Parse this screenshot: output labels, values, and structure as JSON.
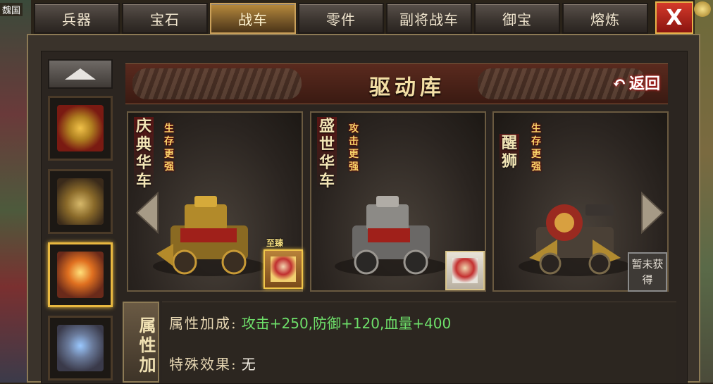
{
  "region_label": "魏国",
  "tabs": [
    {
      "label": "兵器"
    },
    {
      "label": "宝石"
    },
    {
      "label": "战车"
    },
    {
      "label": "零件"
    },
    {
      "label": "副将战车"
    },
    {
      "label": "御宝"
    },
    {
      "label": "熔炼"
    }
  ],
  "active_tab": "战车",
  "close_label": "X",
  "panel": {
    "title": "驱动库",
    "back_label": "返回"
  },
  "chariots": [
    {
      "name": "庆典华车",
      "tag": "生存更强",
      "badge_label": "至臻",
      "owned": true
    },
    {
      "name": "盛世华车",
      "tag": "攻击更强",
      "owned": true
    },
    {
      "name": "醒狮",
      "tag": "生存更强",
      "locked_label": "暂未获得",
      "owned": false
    }
  ],
  "attributes": {
    "section_label": "属性加",
    "bonus_key": "属性加成:",
    "bonus_value": "攻击+250,防御+120,血量+400",
    "special_key": "特殊效果:",
    "special_value": "无"
  },
  "colors": {
    "accent_gold": "#e8b840",
    "bonus_green": "#6ee06a",
    "close_red": "#c8281e"
  }
}
